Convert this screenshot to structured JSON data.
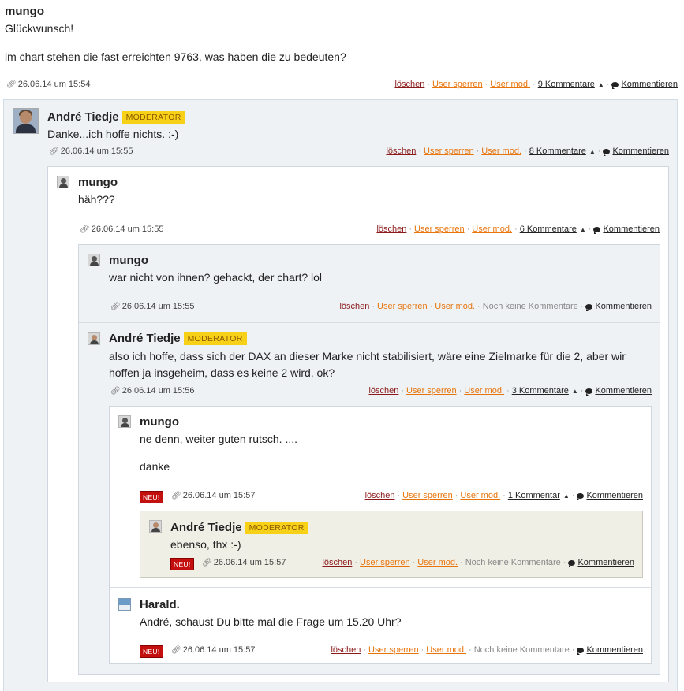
{
  "root": {
    "author": "mungo",
    "text1": "Glückwunsch!",
    "text2": "im chart stehen die fast erreichten 9763, was haben die zu bedeuten?",
    "date": "26.06.14 um 15:54",
    "count": "9 Kommentare"
  },
  "labels": {
    "delete": "löschen",
    "ban": "User sperren",
    "mod": "User mod.",
    "comment": "Kommentieren",
    "none": "Noch keine Kommentare",
    "moderator": "MODERATOR",
    "new": "NEU!"
  },
  "c1": {
    "author": "André Tiedje",
    "text": "Danke...ich hoffe nichts. :-)",
    "date": "26.06.14 um 15:55",
    "count": "8 Kommentare"
  },
  "c2": {
    "author": "mungo",
    "text": "häh???",
    "date": "26.06.14 um 15:55",
    "count": "6 Kommentare"
  },
  "c3": {
    "author": "mungo",
    "text": "war nicht von ihnen? gehackt, der chart? lol",
    "date": "26.06.14 um 15:55"
  },
  "c4": {
    "author": "André Tiedje",
    "text1": "also ich hoffe, dass sich der DAX an dieser Marke nicht stabilisiert, wäre eine Zielmarke für die 2, aber wir",
    "text2": "hoffen ja insgeheim, dass es keine 2 wird, ok?",
    "date": "26.06.14 um 15:56",
    "count": "3 Kommentare"
  },
  "c5": {
    "author": "mungo",
    "text1": "ne denn, weiter guten rutsch. ....",
    "text2": "danke",
    "date": "26.06.14 um 15:57",
    "count": "1 Kommentar"
  },
  "c6": {
    "author": "André Tiedje",
    "text": "ebenso, thx :-)",
    "date": "26.06.14 um 15:57"
  },
  "c7": {
    "author": "Harald.",
    "text": "André, schaust Du bitte mal die Frage um 15.20 Uhr?",
    "date": "26.06.14 um 15:57"
  }
}
